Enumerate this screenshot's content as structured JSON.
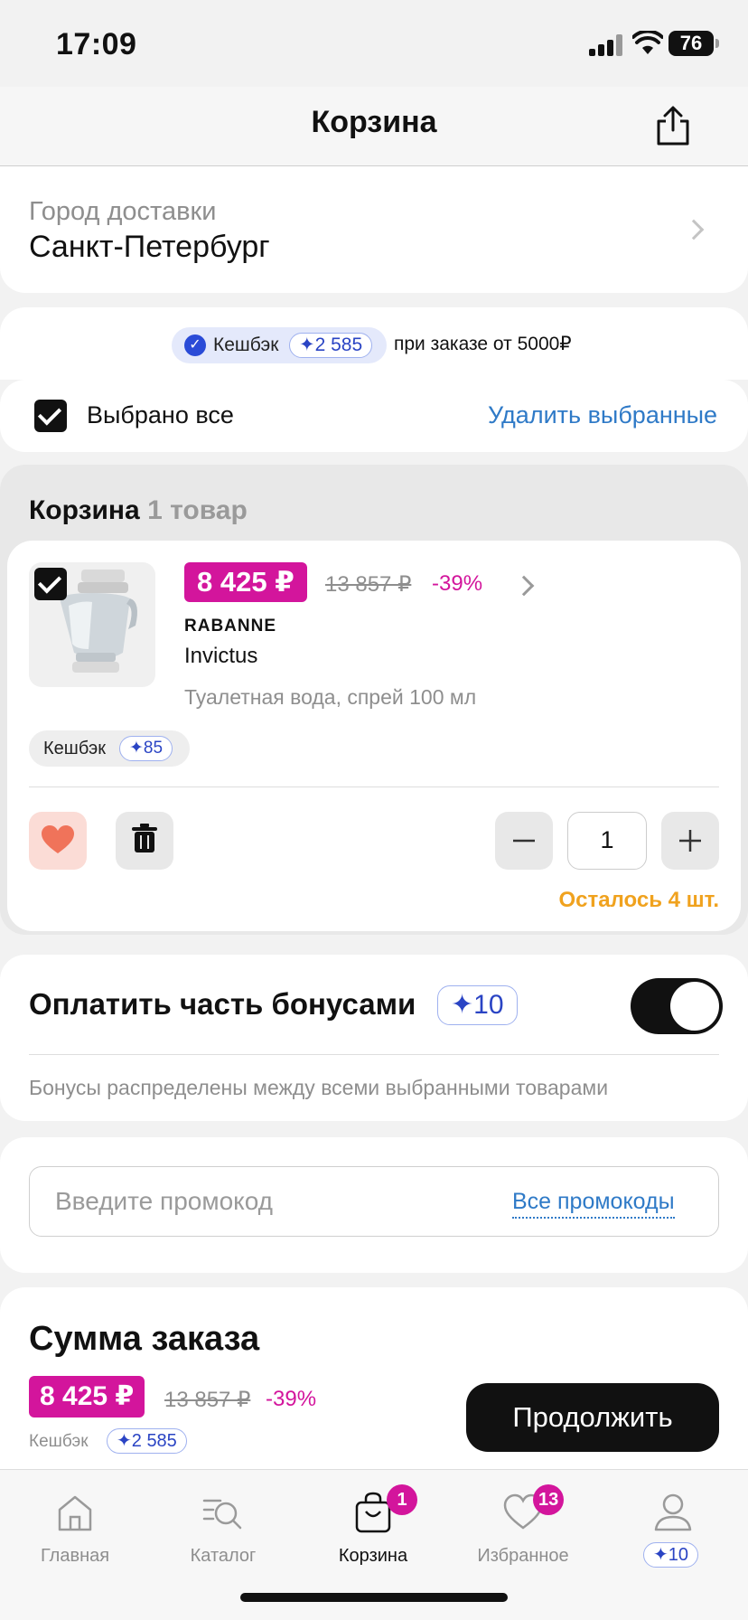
{
  "status": {
    "time": "17:09",
    "battery": "76"
  },
  "header": {
    "title": "Корзина"
  },
  "delivery": {
    "label": "Город доставки",
    "city": "Санкт-Петербург"
  },
  "cashback_banner": {
    "label": "Кешбэк",
    "amount": "✦2 585",
    "note": "при заказе от 5000₽"
  },
  "selection": {
    "select_all": "Выбрано все",
    "delete_selected": "Удалить выбранные"
  },
  "cart": {
    "heading": "Корзина",
    "count": "1 товар",
    "item": {
      "price": "8 425 ₽",
      "old_price": "13 857 ₽",
      "discount": "-39%",
      "brand": "RABANNE",
      "name": "Invictus",
      "description": "Туалетная вода, спрей 100 мл",
      "cashback_label": "Кешбэк",
      "cashback_amount": "✦85",
      "quantity": "1",
      "stock_left": "Осталось 4 шт."
    }
  },
  "bonus": {
    "title": "Оплатить часть бонусами",
    "amount": "✦10",
    "enabled": true,
    "note": "Бонусы распределены между всеми выбранными товарами"
  },
  "promo": {
    "placeholder": "Введите промокод",
    "all_link": "Все промокоды"
  },
  "summary": {
    "title": "Сумма заказа"
  },
  "bottom_bar": {
    "price": "8 425 ₽",
    "old_price": "13 857 ₽",
    "discount": "-39%",
    "cashback_label": "Кешбэк",
    "cashback_amount": "✦2 585",
    "continue": "Продолжить"
  },
  "tabbar": {
    "items": [
      {
        "label": "Главная",
        "icon": "home-icon"
      },
      {
        "label": "Каталог",
        "icon": "catalog-search-icon"
      },
      {
        "label": "Корзина",
        "icon": "bag-icon",
        "badge": "1",
        "active": true
      },
      {
        "label": "Избранное",
        "icon": "heart-icon",
        "badge": "13"
      },
      {
        "label": "✦10",
        "icon": "profile-icon"
      }
    ]
  },
  "colors": {
    "accent_pink": "#d3159c",
    "link_blue": "#2f7ac7",
    "bonus_blue": "#2a44c4",
    "stock_orange": "#f0a21e"
  }
}
